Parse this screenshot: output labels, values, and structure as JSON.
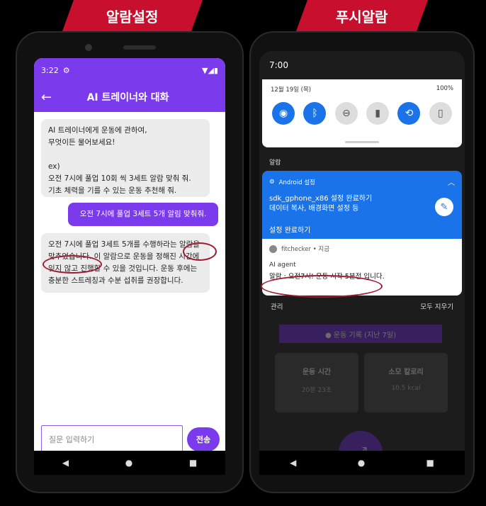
{
  "banners": {
    "left": "알람설정",
    "right": "푸시알람"
  },
  "left_phone": {
    "status": {
      "time": "3:22",
      "settings_icon": "gear-icon",
      "signal_icons": "wifi-signal-battery-icons"
    },
    "appbar": {
      "back_icon": "back-arrow-icon",
      "title": "AI 트레이너와 대화"
    },
    "messages": [
      {
        "sender": "bot",
        "text": "AI 트레이너에게 운동에 관하여,\n무엇이든 물어보세요!\n\nex)\n오전 7시에 풀업 10회 씩 3세트 알람 맞춰 줘.\n기초 체력을 기를 수 있는 운동 추천해 줘."
      },
      {
        "sender": "user",
        "text": "오전 7시에 풀업 3세트 5개 알림 맞춰줘."
      },
      {
        "sender": "bot",
        "text": "오전 7시에 풀업 3세트 5개를 수행하라는 알람을 맞추었습니다. 이 알람으로 운동을 정해진 시간에 잊지 않고 진행할 수 있을 것입니다. 운동 후에는 충분한 스트레칭과 수분 섭취를 권장합니다."
      }
    ],
    "input_placeholder": "질문 입력하기",
    "send_label": "전송",
    "nav": {
      "back": "◀",
      "home": "●",
      "recent": "■"
    }
  },
  "right_phone": {
    "status_time": "7:00",
    "quick_settings": {
      "date": "12월 19일 (목)",
      "battery": "100%",
      "tiles": [
        {
          "icon": "wifi-icon",
          "glyph": "◉",
          "state": "on"
        },
        {
          "icon": "bluetooth-icon",
          "glyph": "ᛒ",
          "state": "on"
        },
        {
          "icon": "dnd-icon",
          "glyph": "⊖",
          "state": "off"
        },
        {
          "icon": "flashlight-icon",
          "glyph": "▮",
          "state": "off"
        },
        {
          "icon": "rotate-icon",
          "glyph": "⟲",
          "state": "on"
        },
        {
          "icon": "battery-saver-icon",
          "glyph": "▯",
          "state": "off"
        }
      ]
    },
    "section_alarm": "알람",
    "notification_setup": {
      "app": "Android 설정",
      "title": "sdk_gphone_x86 설정 완료하기\n데이터 복사, 배경화면 설정 등",
      "action": "설정 완료하기"
    },
    "notification_app": {
      "header": "fitchecker • 지금",
      "app_name": "AI agent",
      "body": "알람 : 오전7시! 운동 시작 5분전 입니다."
    },
    "manage": "관리",
    "clear_all": "모두 지우기",
    "background_app": {
      "banner": "● 운동 기록 (지난 7일)",
      "card1_label": "운동 시간",
      "card1_value": "20분 23초",
      "card2_label": "소모 칼로리",
      "card2_value": "10.5 kcal"
    },
    "nav": {
      "back": "◀",
      "home": "●",
      "recent": "■"
    }
  },
  "accent_colors": {
    "purple": "#7c3aed",
    "blue": "#1a73e8",
    "red": "#c8102e"
  }
}
